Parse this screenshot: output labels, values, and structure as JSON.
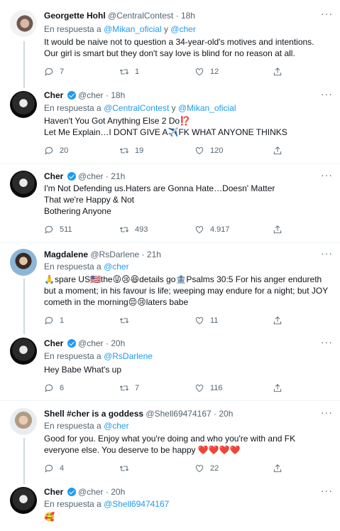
{
  "tweets": [
    {
      "name": "Georgette Hohl",
      "handle": "@CentralContest",
      "dot": "·",
      "time": "18h",
      "reply_prefix": "En respuesta a",
      "reply_to_1": "@Mikan_oficial",
      "reply_and": "y",
      "reply_to_2": "@cher",
      "lines": [
        "It would be naive not to question a 34-year-old's motives and intentions.",
        "Our girl is smart but they don't say love is blind for no reason at all."
      ],
      "replies": "7",
      "retweets": "1",
      "likes": "12"
    },
    {
      "name": "Cher",
      "handle": "@cher",
      "dot": "·",
      "time": "18h",
      "reply_prefix": "En respuesta a",
      "reply_to_1": "@CentralContest",
      "reply_and": "y",
      "reply_to_2": "@Mikan_oficial",
      "lines": [
        "Haven't You Got Anything Else 2 Do⁉️",
        "Let Me Explain…I DONT GIVE A✈️FK WHAT ANYONE THINKS"
      ],
      "replies": "20",
      "retweets": "19",
      "likes": "120"
    },
    {
      "name": "Cher",
      "handle": "@cher",
      "dot": "·",
      "time": "21h",
      "lines": [
        "I'm Not Defending us.Haters are Gonna Hate…Doesn' Matter",
        "That we're Happy & Not",
        "Bothering Anyone"
      ],
      "replies": "511",
      "retweets": "493",
      "likes": "4.917"
    },
    {
      "name": "Magdalene",
      "handle": "@RsDarlene",
      "dot": "·",
      "time": "21h",
      "reply_prefix": "En respuesta a",
      "reply_to_1": "@cher",
      "text": "🙏spare US🇺🇸the😜😢😆details go🏦Psalms 30:5 For his anger endureth but a moment; in his favour is life; weeping may endure for a night; but JOY cometh in the morning😔😢laters babe",
      "replies": "1",
      "likes": "11"
    },
    {
      "name": "Cher",
      "handle": "@cher",
      "dot": "·",
      "time": "20h",
      "reply_prefix": "En respuesta a",
      "reply_to_1": "@RsDarlene",
      "lines": [
        "Hey Babe What's up"
      ],
      "replies": "6",
      "retweets": "7",
      "likes": "116"
    },
    {
      "name": "Shell #cher is a goddess",
      "handle": "@Shell69474167",
      "dot": "·",
      "time": "20h",
      "reply_prefix": "En respuesta a",
      "reply_to_1": "@cher",
      "text": "Good for you. Enjoy what you're doing and who you're with and FK everyone else. You deserve to be happy ❤️❤️❤️❤️",
      "replies": "4",
      "likes": "22"
    },
    {
      "name": "Cher",
      "handle": "@cher",
      "dot": "·",
      "time": "20h",
      "reply_prefix": "En respuesta a",
      "reply_to_1": "@Shell69474167",
      "lines": [
        "🥰"
      ]
    }
  ],
  "icons": {
    "more": "more-icon",
    "reply": "reply-icon",
    "retweet": "retweet-icon",
    "like": "heart-icon",
    "share": "share-icon",
    "verified": "verified-badge-icon"
  },
  "colors": {
    "link": "#1d9bf0",
    "meta": "#536471",
    "text": "#0f1419"
  }
}
